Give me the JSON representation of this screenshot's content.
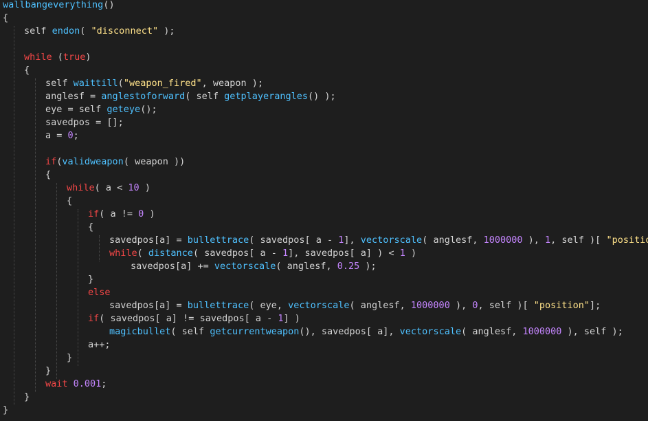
{
  "colors": {
    "background": "#1e1e1e",
    "text": "#d4d4d4",
    "function": "#4fc1ff",
    "keyword": "#f44747",
    "string": "#ffe28a",
    "number": "#c586ff"
  },
  "code_lines": [
    {
      "indent": 0,
      "tokens": [
        {
          "t": "wallbangeverything",
          "c": "fn"
        },
        {
          "t": "()",
          "c": "txt"
        }
      ]
    },
    {
      "indent": 0,
      "tokens": [
        {
          "t": "{",
          "c": "txt"
        }
      ]
    },
    {
      "indent": 1,
      "tokens": [
        {
          "t": "self ",
          "c": "txt"
        },
        {
          "t": "endon",
          "c": "fn"
        },
        {
          "t": "( ",
          "c": "txt"
        },
        {
          "t": "\"disconnect\"",
          "c": "str"
        },
        {
          "t": " );",
          "c": "txt"
        }
      ]
    },
    {
      "indent": 0,
      "tokens": []
    },
    {
      "indent": 1,
      "tokens": [
        {
          "t": "while",
          "c": "kw"
        },
        {
          "t": " (",
          "c": "txt"
        },
        {
          "t": "true",
          "c": "kw"
        },
        {
          "t": ")",
          "c": "txt"
        }
      ]
    },
    {
      "indent": 1,
      "tokens": [
        {
          "t": "{",
          "c": "txt"
        }
      ]
    },
    {
      "indent": 2,
      "tokens": [
        {
          "t": "self ",
          "c": "txt"
        },
        {
          "t": "waittill",
          "c": "fn"
        },
        {
          "t": "(",
          "c": "txt"
        },
        {
          "t": "\"weapon_fired\"",
          "c": "str"
        },
        {
          "t": ", weapon );",
          "c": "txt"
        }
      ]
    },
    {
      "indent": 2,
      "tokens": [
        {
          "t": "anglesf = ",
          "c": "txt"
        },
        {
          "t": "anglestoforward",
          "c": "fn"
        },
        {
          "t": "( self ",
          "c": "txt"
        },
        {
          "t": "getplayerangles",
          "c": "fn"
        },
        {
          "t": "() );",
          "c": "txt"
        }
      ]
    },
    {
      "indent": 2,
      "tokens": [
        {
          "t": "eye = self ",
          "c": "txt"
        },
        {
          "t": "geteye",
          "c": "fn"
        },
        {
          "t": "();",
          "c": "txt"
        }
      ]
    },
    {
      "indent": 2,
      "tokens": [
        {
          "t": "savedpos = [];",
          "c": "txt"
        }
      ]
    },
    {
      "indent": 2,
      "tokens": [
        {
          "t": "a = ",
          "c": "txt"
        },
        {
          "t": "0",
          "c": "num"
        },
        {
          "t": ";",
          "c": "txt"
        }
      ]
    },
    {
      "indent": 0,
      "tokens": []
    },
    {
      "indent": 2,
      "tokens": [
        {
          "t": "if",
          "c": "kw"
        },
        {
          "t": "(",
          "c": "txt"
        },
        {
          "t": "validweapon",
          "c": "fn"
        },
        {
          "t": "( weapon ))",
          "c": "txt"
        }
      ]
    },
    {
      "indent": 2,
      "tokens": [
        {
          "t": "{",
          "c": "txt"
        }
      ]
    },
    {
      "indent": 3,
      "tokens": [
        {
          "t": "while",
          "c": "kw"
        },
        {
          "t": "( a < ",
          "c": "txt"
        },
        {
          "t": "10",
          "c": "num"
        },
        {
          "t": " )",
          "c": "txt"
        }
      ]
    },
    {
      "indent": 3,
      "tokens": [
        {
          "t": "{",
          "c": "txt"
        }
      ]
    },
    {
      "indent": 4,
      "tokens": [
        {
          "t": "if",
          "c": "kw"
        },
        {
          "t": "( a != ",
          "c": "txt"
        },
        {
          "t": "0",
          "c": "num"
        },
        {
          "t": " )",
          "c": "txt"
        }
      ]
    },
    {
      "indent": 4,
      "tokens": [
        {
          "t": "{",
          "c": "txt"
        }
      ]
    },
    {
      "indent": 5,
      "tokens": [
        {
          "t": "savedpos[a] = ",
          "c": "txt"
        },
        {
          "t": "bullettrace",
          "c": "fn"
        },
        {
          "t": "( savedpos[ a - ",
          "c": "txt"
        },
        {
          "t": "1",
          "c": "num"
        },
        {
          "t": "], ",
          "c": "txt"
        },
        {
          "t": "vectorscale",
          "c": "fn"
        },
        {
          "t": "( anglesf, ",
          "c": "txt"
        },
        {
          "t": "1000000",
          "c": "num"
        },
        {
          "t": " ), ",
          "c": "txt"
        },
        {
          "t": "1",
          "c": "num"
        },
        {
          "t": ", self )[ ",
          "c": "txt"
        },
        {
          "t": "\"position\"",
          "c": "str"
        },
        {
          "t": "];",
          "c": "txt"
        }
      ]
    },
    {
      "indent": 5,
      "tokens": [
        {
          "t": "while",
          "c": "kw"
        },
        {
          "t": "( ",
          "c": "txt"
        },
        {
          "t": "distance",
          "c": "fn"
        },
        {
          "t": "( savedpos[ a - ",
          "c": "txt"
        },
        {
          "t": "1",
          "c": "num"
        },
        {
          "t": "], savedpos[ a] ) < ",
          "c": "txt"
        },
        {
          "t": "1",
          "c": "num"
        },
        {
          "t": " )",
          "c": "txt"
        }
      ]
    },
    {
      "indent": 6,
      "tokens": [
        {
          "t": "savedpos[a] += ",
          "c": "txt"
        },
        {
          "t": "vectorscale",
          "c": "fn"
        },
        {
          "t": "( anglesf, ",
          "c": "txt"
        },
        {
          "t": "0.25",
          "c": "num"
        },
        {
          "t": " );",
          "c": "txt"
        }
      ]
    },
    {
      "indent": 4,
      "tokens": [
        {
          "t": "}",
          "c": "txt"
        }
      ]
    },
    {
      "indent": 4,
      "tokens": [
        {
          "t": "else",
          "c": "kw"
        }
      ]
    },
    {
      "indent": 5,
      "tokens": [
        {
          "t": "savedpos[a] = ",
          "c": "txt"
        },
        {
          "t": "bullettrace",
          "c": "fn"
        },
        {
          "t": "( eye, ",
          "c": "txt"
        },
        {
          "t": "vectorscale",
          "c": "fn"
        },
        {
          "t": "( anglesf, ",
          "c": "txt"
        },
        {
          "t": "1000000",
          "c": "num"
        },
        {
          "t": " ), ",
          "c": "txt"
        },
        {
          "t": "0",
          "c": "num"
        },
        {
          "t": ", self )[ ",
          "c": "txt"
        },
        {
          "t": "\"position\"",
          "c": "str"
        },
        {
          "t": "];",
          "c": "txt"
        }
      ]
    },
    {
      "indent": 4,
      "tokens": [
        {
          "t": "if",
          "c": "kw"
        },
        {
          "t": "( savedpos[ a] != savedpos[ a - ",
          "c": "txt"
        },
        {
          "t": "1",
          "c": "num"
        },
        {
          "t": "] )",
          "c": "txt"
        }
      ]
    },
    {
      "indent": 5,
      "tokens": [
        {
          "t": "magicbullet",
          "c": "fn"
        },
        {
          "t": "( self ",
          "c": "txt"
        },
        {
          "t": "getcurrentweapon",
          "c": "fn"
        },
        {
          "t": "(), savedpos[ a], ",
          "c": "txt"
        },
        {
          "t": "vectorscale",
          "c": "fn"
        },
        {
          "t": "( anglesf, ",
          "c": "txt"
        },
        {
          "t": "1000000",
          "c": "num"
        },
        {
          "t": " ), self );",
          "c": "txt"
        }
      ]
    },
    {
      "indent": 4,
      "tokens": [
        {
          "t": "a++;",
          "c": "txt"
        }
      ]
    },
    {
      "indent": 3,
      "tokens": [
        {
          "t": "}",
          "c": "txt"
        }
      ]
    },
    {
      "indent": 2,
      "tokens": [
        {
          "t": "}",
          "c": "txt"
        }
      ]
    },
    {
      "indent": 2,
      "tokens": [
        {
          "t": "wait",
          "c": "kw"
        },
        {
          "t": " ",
          "c": "txt"
        },
        {
          "t": "0.001",
          "c": "num"
        },
        {
          "t": ";",
          "c": "txt"
        }
      ]
    },
    {
      "indent": 1,
      "tokens": [
        {
          "t": "}",
          "c": "txt"
        }
      ]
    },
    {
      "indent": 0,
      "tokens": [
        {
          "t": "}",
          "c": "txt"
        }
      ]
    }
  ],
  "indent_guides": [
    {
      "level": 1,
      "from": 2,
      "to": 31
    },
    {
      "level": 2,
      "from": 6,
      "to": 30
    },
    {
      "level": 3,
      "from": 14,
      "to": 29
    },
    {
      "level": 4,
      "from": 16,
      "to": 28
    },
    {
      "level": 5,
      "from": 18,
      "to": 20
    }
  ]
}
